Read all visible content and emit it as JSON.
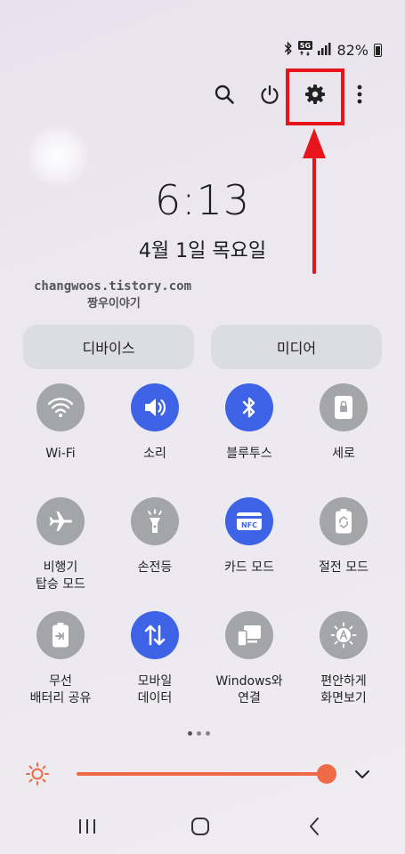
{
  "status_bar": {
    "icons": [
      "bluetooth-icon",
      "5g-icon",
      "signal-icon",
      "battery-icon"
    ],
    "battery": "82%"
  },
  "top_icons": [
    "search-icon",
    "power-icon",
    "gear-icon",
    "more-vert-icon"
  ],
  "clock": {
    "time": "6:13",
    "date": "4월 1일 목요일"
  },
  "watermark": {
    "line1": "changwoos.tistory.com",
    "line2": "짱우이야기"
  },
  "media_buttons": {
    "devices": "디바이스",
    "media": "미디어"
  },
  "tiles": [
    {
      "label": "Wi-Fi",
      "icon": "wifi-icon",
      "active": false
    },
    {
      "label": "소리",
      "icon": "volume-icon",
      "active": true
    },
    {
      "label": "블루투스",
      "icon": "bluetooth-icon",
      "active": true
    },
    {
      "label": "세로",
      "icon": "portrait-lock-icon",
      "active": false
    },
    {
      "label": "비행기\n탑승 모드",
      "icon": "airplane-icon",
      "active": false
    },
    {
      "label": "손전등",
      "icon": "flashlight-icon",
      "active": false
    },
    {
      "label": "카드 모드",
      "icon": "nfc-icon",
      "icon_text": "NFC",
      "active": true
    },
    {
      "label": "절전 모드",
      "icon": "power-saving-icon",
      "active": false
    },
    {
      "label": "무선\n배터리 공유",
      "icon": "wireless-battery-icon",
      "active": false
    },
    {
      "label": "모바일\n데이터",
      "icon": "mobile-data-icon",
      "active": true
    },
    {
      "label": "Windows와\n연결",
      "icon": "link-to-windows-icon",
      "active": false
    },
    {
      "label": "편안하게\n화면보기",
      "icon": "eye-comfort-icon",
      "active": false
    }
  ],
  "page_indicator": {
    "count": 3,
    "active": 0
  },
  "brightness": {
    "level": 0.96
  },
  "nav_bar": [
    "recents-icon",
    "home-icon",
    "back-icon"
  ],
  "colors": {
    "accent": "#3f63e6",
    "inactive": "#a3a5a9",
    "slider": "#ee6a47",
    "highlight": "#e8141b"
  }
}
